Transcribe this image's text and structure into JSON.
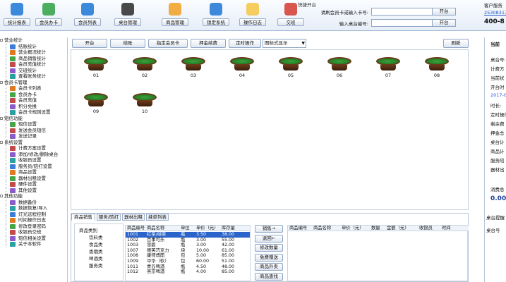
{
  "toolbar": [
    {
      "label": "统计报表",
      "icon": "bar-chart-icon"
    },
    {
      "label": "会员办卡",
      "icon": "add-member-icon"
    },
    {
      "label": "会员列表",
      "icon": "member-group-icon"
    },
    {
      "label": "桌台管理",
      "icon": "table-manage-icon"
    },
    {
      "label": "商品管理",
      "icon": "goods-icon"
    },
    {
      "label": "锁定系统",
      "icon": "lock-icon"
    },
    {
      "label": "操作日志",
      "icon": "log-icon"
    },
    {
      "label": "交班",
      "icon": "shift-icon"
    }
  ],
  "op": {
    "title": "快捷开台",
    "row1_label": "请刷会员卡或输入卡号:",
    "row2_label": "输入桌台编号:",
    "btn": "开台"
  },
  "service": {
    "title": "客户服务",
    "qq": "2530831735",
    "phone": "400-8"
  },
  "sidebar": {
    "groups": [
      {
        "label": "营业统计",
        "items": [
          "结账统计",
          "营业概况统计",
          "商品销售统计",
          "会员充值统计",
          "交班统计",
          "查看账务统计"
        ]
      },
      {
        "label": "会员卡管理",
        "items": [
          "会员卡列表",
          "会员办卡",
          "会员充值",
          "积分兑换",
          "会员卡规则设置"
        ]
      },
      {
        "label": "短信功能",
        "items": [
          "短信设置",
          "发送会员短信",
          "发送记录"
        ]
      },
      {
        "label": "系统设置",
        "items": [
          "计费方案设置",
          "添加/修改/删除桌台",
          "收银员设置",
          "服务员/陪打设置",
          "商品设置",
          "器材出租设置",
          "硬件设置",
          "其他设置"
        ]
      },
      {
        "label": "其他功能",
        "items": [
          "数据备份",
          "数据恢复/导入",
          "灯光远程控制",
          "时间操作日志",
          "修改登录密码",
          "收银员交班",
          "短信相关设置",
          "关于本软件"
        ]
      }
    ]
  },
  "main_buttons": [
    "开台",
    "结账",
    "指定会员卡",
    "押金续费",
    "定时操作"
  ],
  "view_select": "图标式显示",
  "refresh": "刷新",
  "tables": [
    "01",
    "02",
    "03",
    "04",
    "05",
    "06",
    "07",
    "08",
    "09",
    "10"
  ],
  "bottom": {
    "tabs": [
      "商品销售",
      "服务/陪打",
      "器材出租",
      "挂单列表"
    ],
    "categories": [
      "商品类别",
      "饮料类",
      "食品类",
      "香烟类",
      "啤酒类",
      "服务类"
    ],
    "goods_headers": [
      "商品编号",
      "商品名称",
      "单位",
      "单价（元）",
      "库存量"
    ],
    "goods": [
      [
        "1001",
        "红茶/绿茶",
        "瓶",
        "3.50",
        "38.00"
      ],
      [
        "1002",
        "百事可乐",
        "瓶",
        "3.00",
        "55.00"
      ],
      [
        "1003",
        "雪碧",
        "瓶",
        "3.00",
        "42.00"
      ],
      [
        "1007",
        "德芙巧克力",
        "块",
        "10.00",
        "61.00"
      ],
      [
        "1008",
        "康师傅面",
        "包",
        "5.00",
        "85.00"
      ],
      [
        "1009",
        "中华（软）",
        "包",
        "60.00",
        "51.00"
      ],
      [
        "1011",
        "青岛啤酒",
        "瓶",
        "4.50",
        "48.00"
      ],
      [
        "1012",
        "燕京啤酒",
        "瓶",
        "4.00",
        "85.00"
      ]
    ],
    "side_buttons": [
      "销售→",
      "退回←",
      "修改数量",
      "免费赠送",
      "商品外卖",
      "商品查找"
    ],
    "order_headers": [
      "商品编号",
      "商品名称",
      "单价（元）",
      "数量",
      "金额（元）",
      "收银员",
      "时间"
    ]
  },
  "right_panel": {
    "title": "当前",
    "rows": [
      "桌台号:",
      "计费方",
      "当前状",
      "开台时",
      "2017-07",
      "时长:",
      "定时操作",
      "剩余费",
      "押金总",
      "桌台计",
      "商品计",
      "服务陪",
      "器材出"
    ],
    "total_label": "消费总",
    "total_value": "0.00",
    "bottom_title": "桌台提醒",
    "bottom_row": "桌台号"
  }
}
